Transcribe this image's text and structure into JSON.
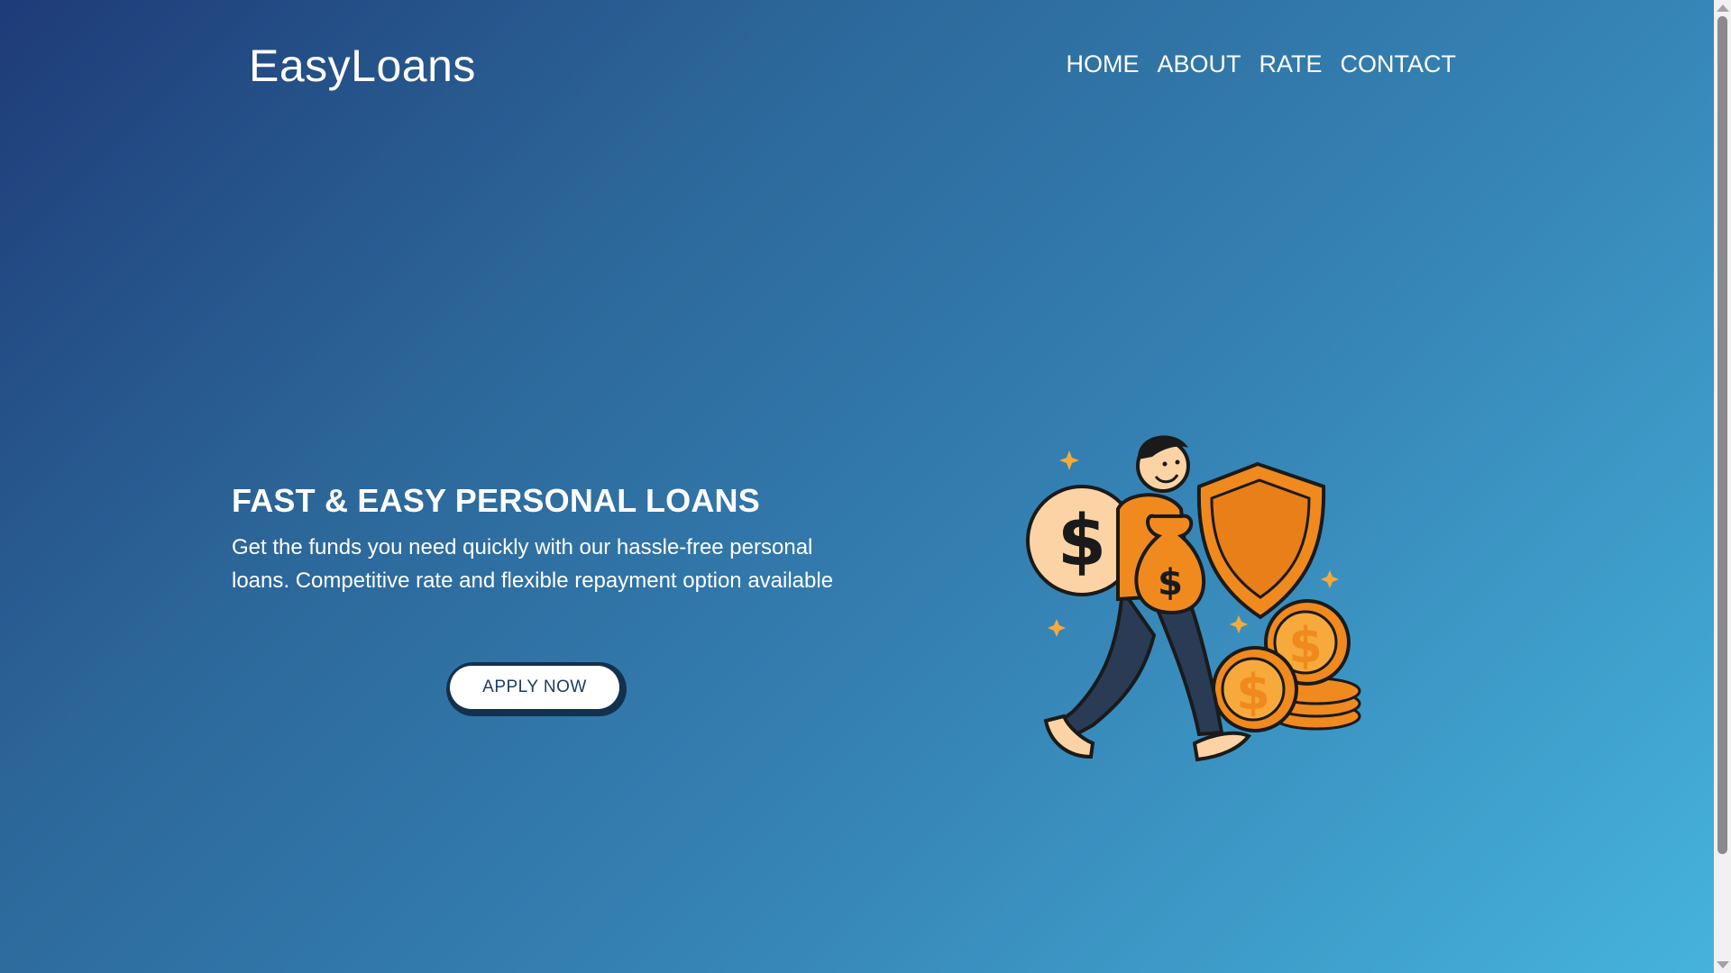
{
  "header": {
    "logo": "EasyLoans",
    "nav": [
      "HOME",
      "ABOUT",
      "RATE",
      "CONTACT"
    ]
  },
  "hero": {
    "title": "FAST & EASY PERSONAL LOANS",
    "description": "Get the funds you need quickly with our hassle-free personal loans. Competitive rate and flexible repayment option available",
    "cta_label": "APPLY NOW"
  },
  "illustration": {
    "name": "man-with-money-bag-illustration",
    "icons": [
      "dollar-coin-icon",
      "shield-icon",
      "money-bag-icon",
      "coin-stack-icon",
      "sparkle-icon"
    ],
    "colors": {
      "orange": "#f0821c",
      "light_orange": "#f7a93b",
      "peach": "#fcd3a4",
      "navy": "#2a3b55",
      "outline": "#1a1a1a"
    }
  },
  "colors": {
    "background_start": "#1e3b78",
    "background_end": "#46b4dd",
    "button_text": "#1d3b63",
    "button_border": "#14304f"
  }
}
